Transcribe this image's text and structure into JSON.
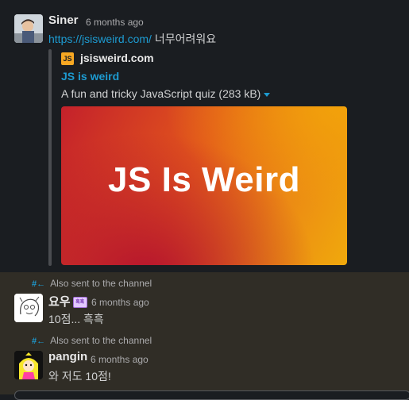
{
  "messages": [
    {
      "sender": "Siner",
      "timestamp": "6 months ago",
      "link": "https://jsisweird.com/",
      "text": "너무어려워요",
      "unfurl": {
        "favicon_text": "JS",
        "site": "jsisweird.com",
        "title": "JS is weird",
        "description": "A fun and tricky JavaScript quiz (283 kB)",
        "preview_text": "JS Is Weird"
      }
    },
    {
      "also_sent": "Also sent to the channel",
      "sender": "요우",
      "emoji_badge": "흑흑",
      "timestamp": "6 months ago",
      "text": "10점... 흑흑"
    },
    {
      "also_sent": "Also sent to the channel",
      "sender": "pangin",
      "timestamp": "6 months ago",
      "text": "와 저도 10점!"
    }
  ],
  "colors": {
    "background": "#1a1d21",
    "thread_highlight": "#302d26",
    "link": "#1d9bd1"
  },
  "icons": {
    "also_sent_arrow": "#←"
  }
}
